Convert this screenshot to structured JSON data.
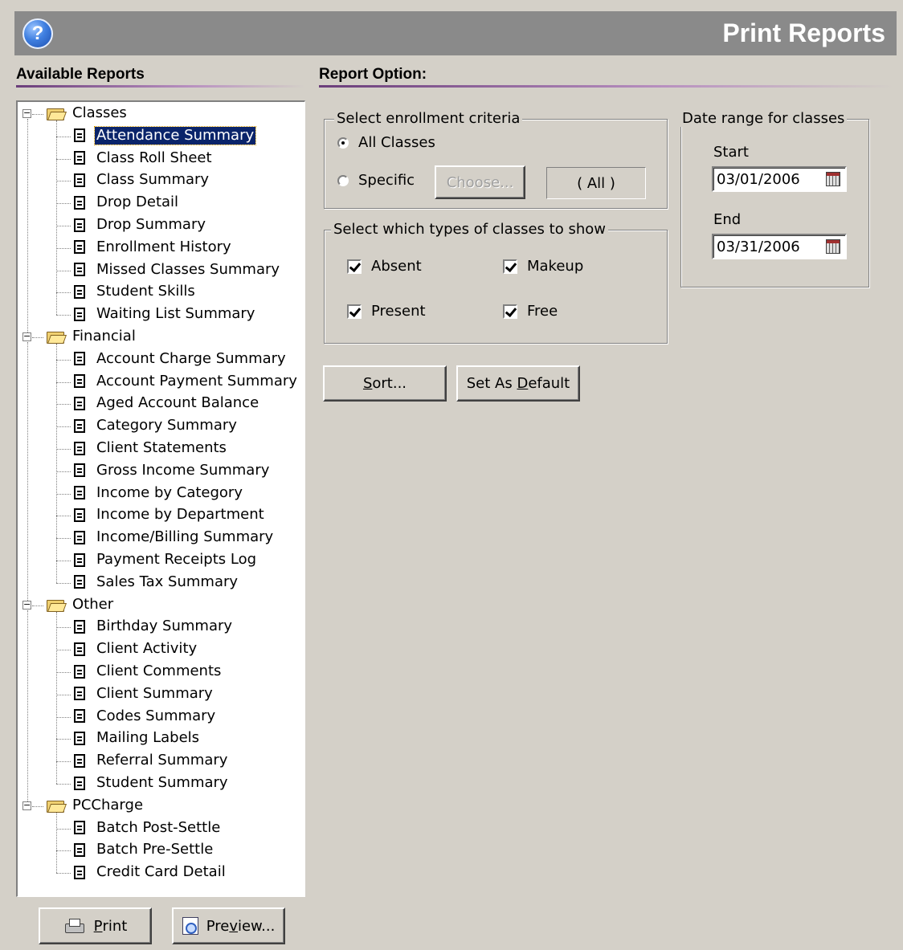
{
  "header": {
    "title": "Print Reports",
    "help_icon": "help-icon"
  },
  "left": {
    "section_title": "Available Reports"
  },
  "right": {
    "section_title": "Report Option:"
  },
  "tree": [
    {
      "label": "Classes",
      "items": [
        "Attendance Summary",
        "Class Roll Sheet",
        "Class Summary",
        "Drop Detail",
        "Drop Summary",
        "Enrollment History",
        "Missed Classes Summary",
        "Student Skills",
        "Waiting List Summary"
      ]
    },
    {
      "label": "Financial",
      "items": [
        "Account Charge Summary",
        "Account Payment Summary",
        "Aged Account Balance",
        "Category Summary",
        "Client Statements",
        "Gross Income Summary",
        "Income by Category",
        "Income by Department",
        "Income/Billing Summary",
        "Payment Receipts Log",
        "Sales Tax Summary"
      ]
    },
    {
      "label": "Other",
      "items": [
        "Birthday Summary",
        "Client Activity",
        "Client Comments",
        "Client Summary",
        "Codes Summary",
        "Mailing Labels",
        "Referral Summary",
        "Student Summary"
      ]
    },
    {
      "label": "PCCharge",
      "items": [
        "Batch Post-Settle",
        "Batch Pre-Settle",
        "Credit Card Detail"
      ]
    }
  ],
  "selected_report": "Attendance Summary",
  "enrollment": {
    "title": "Select enrollment criteria",
    "all_label": "All Classes",
    "specific_label": "Specific",
    "choose_label": "Choose...",
    "selection_display": "( All )",
    "selected": "all"
  },
  "types": {
    "title": "Select which types of classes to show",
    "absent": {
      "label": "Absent",
      "checked": true
    },
    "makeup": {
      "label": "Makeup",
      "checked": true
    },
    "present": {
      "label": "Present",
      "checked": true
    },
    "free": {
      "label": "Free",
      "checked": true
    }
  },
  "date_range": {
    "title": "Date range for classes",
    "start_label": "Start",
    "start_value": "03/01/2006",
    "end_label": "End",
    "end_value": "03/31/2006"
  },
  "buttons": {
    "sort": {
      "pre": "",
      "key": "S",
      "post": "ort..."
    },
    "default": {
      "pre": "Set As ",
      "key": "D",
      "post": "efault"
    },
    "print": {
      "pre": "",
      "key": "P",
      "post": "rint"
    },
    "preview": {
      "pre": "Pre",
      "key": "v",
      "post": "iew..."
    }
  }
}
